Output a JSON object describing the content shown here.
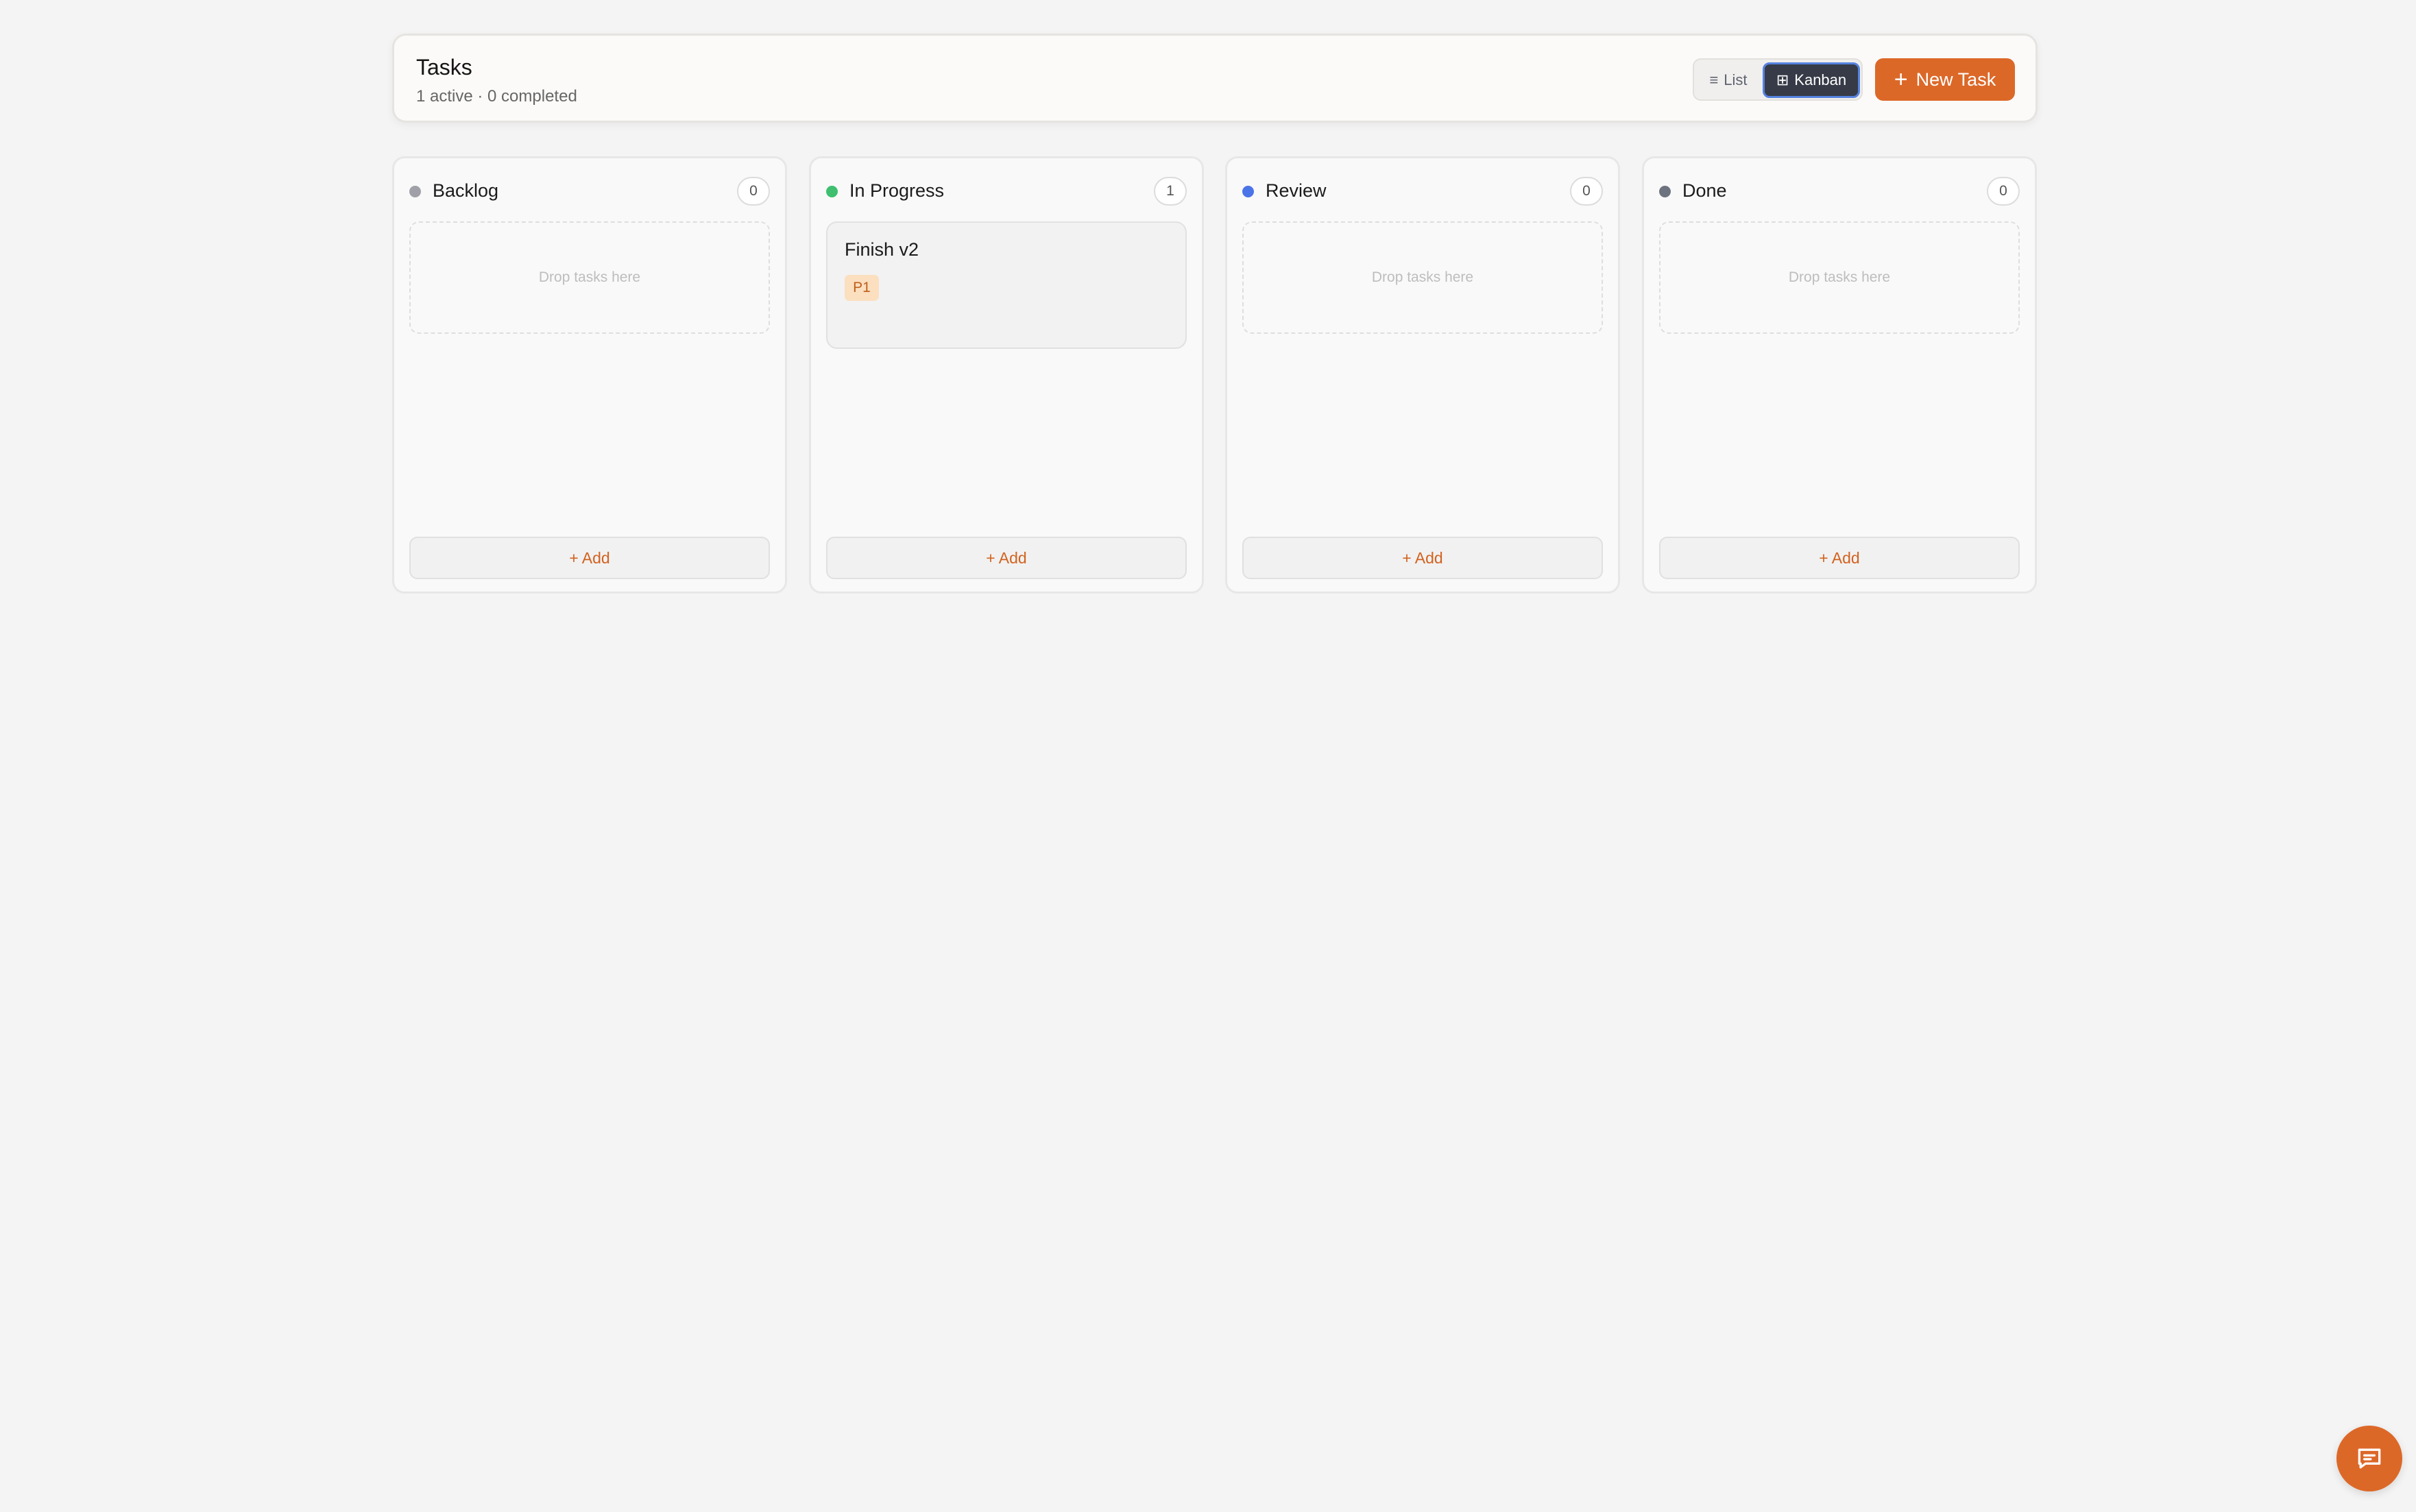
{
  "header": {
    "title": "Tasks",
    "subtitle": "1 active · 0 completed",
    "view_toggle": {
      "list_icon": "≡",
      "list_label": "List",
      "kanban_icon": "⊞",
      "kanban_label": "Kanban",
      "active": "Kanban"
    },
    "new_task_icon": "+",
    "new_task_label": "New Task"
  },
  "columns": [
    {
      "title": "Backlog",
      "count": "0",
      "dot_color": "#a0a0a8",
      "empty_text": "Drop tasks here",
      "add_label": "+ Add"
    },
    {
      "title": "In Progress",
      "count": "1",
      "dot_color": "#3fbf6f",
      "add_label": "+ Add",
      "cards": [
        {
          "title": "Finish v2",
          "priority": "P1"
        }
      ]
    },
    {
      "title": "Review",
      "count": "0",
      "dot_color": "#4b74e8",
      "empty_text": "Drop tasks here",
      "add_label": "+ Add"
    },
    {
      "title": "Done",
      "count": "0",
      "dot_color": "#6e7380",
      "empty_text": "Drop tasks here",
      "add_label": "+ Add"
    }
  ],
  "colors": {
    "accent": "#dc6828",
    "toggle_active_bg": "#363b47"
  },
  "chat_fab": {
    "icon": "chat-icon"
  }
}
